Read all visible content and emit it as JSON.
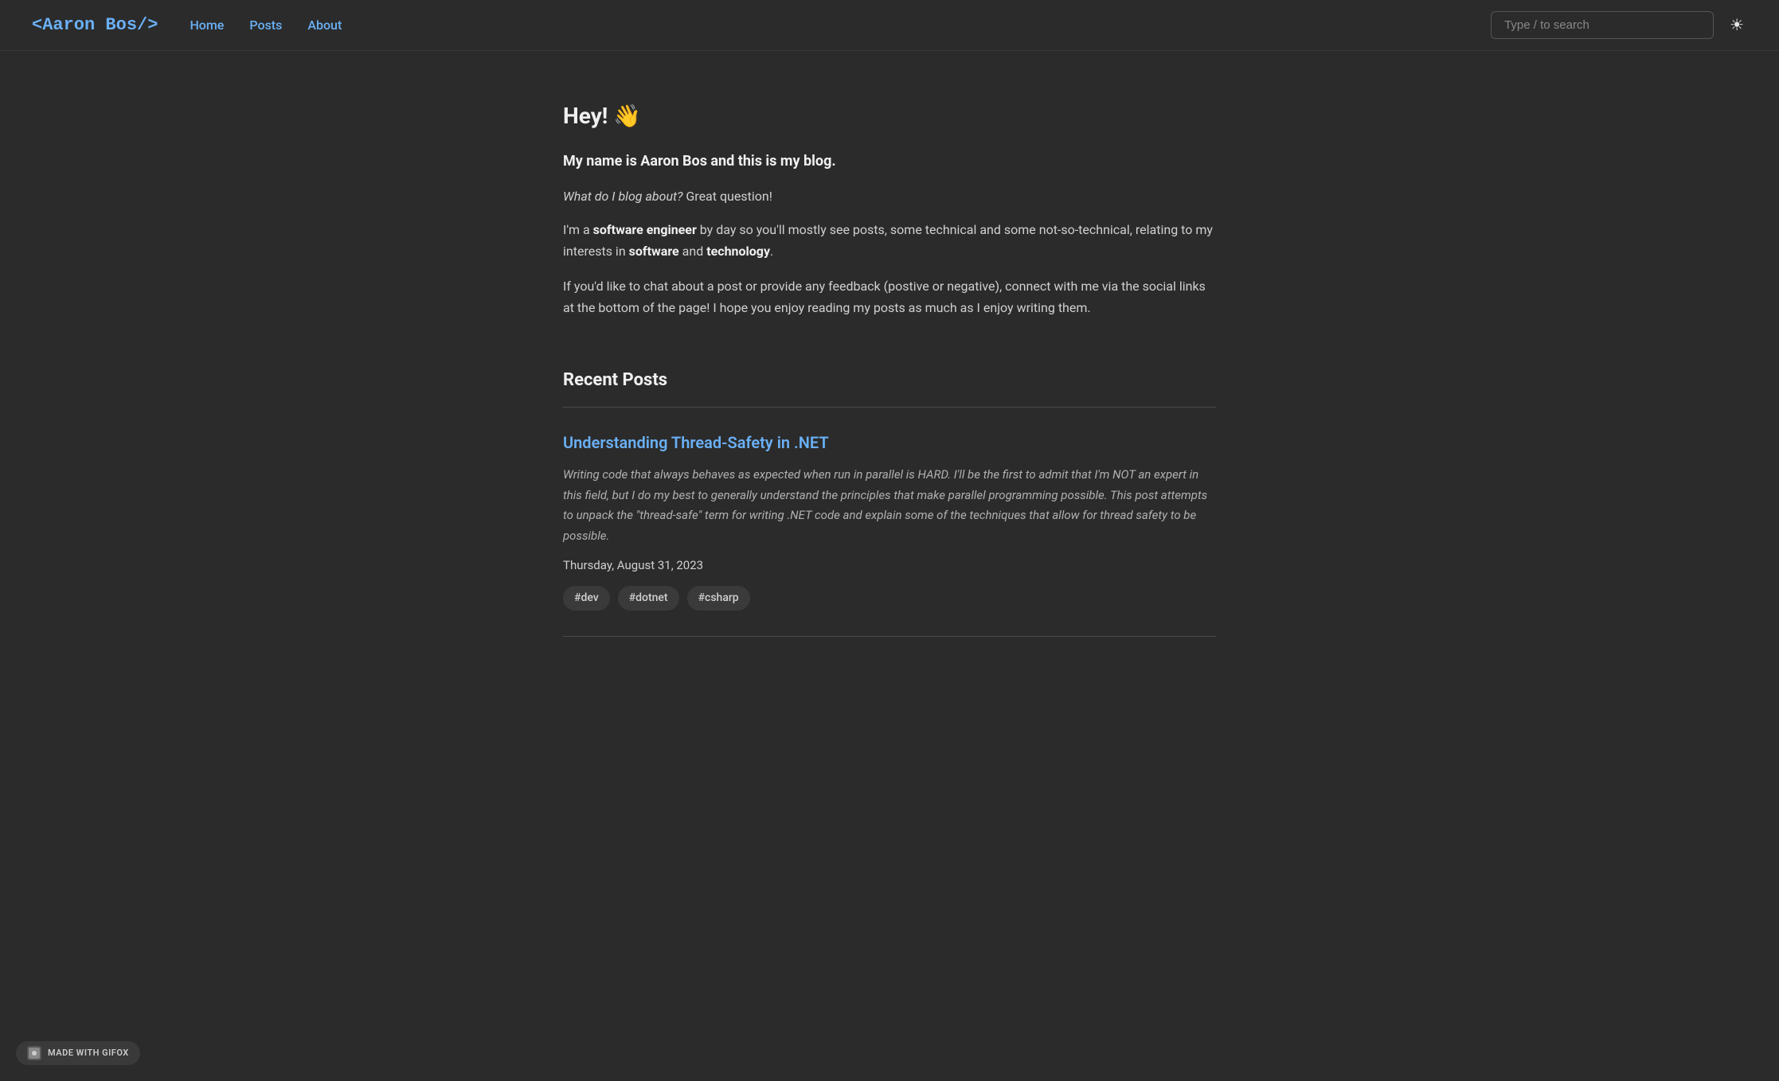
{
  "site": {
    "logo": "<Aaron Bos/>",
    "nav": {
      "links": [
        {
          "label": "Home",
          "href": "#"
        },
        {
          "label": "Posts",
          "href": "#"
        },
        {
          "label": "About",
          "href": "#"
        }
      ]
    },
    "search": {
      "placeholder": "Type / to search"
    },
    "theme_toggle_icon": "☀"
  },
  "hero": {
    "title": "Hey! 👋",
    "subtitle": "My name is Aaron Bos and this is my blog.",
    "question_italic": "What do I blog about?",
    "question_rest": " Great question!",
    "body1_pre": "I'm a ",
    "body1_bold1": "software engineer",
    "body1_mid": " by day so you'll mostly see posts, some technical and some not-so-technical, relating to my interests in ",
    "body1_bold2": "software",
    "body1_and": " and ",
    "body1_bold3": "technology",
    "body1_end": ".",
    "body2": "If you'd like to chat about a post or provide any feedback (postive or negative), connect with me via the social links at the bottom of the page! I hope you enjoy reading my posts as much as I enjoy writing them."
  },
  "recent_posts": {
    "section_title": "Recent Posts",
    "posts": [
      {
        "title": "Understanding Thread-Safety in .NET",
        "href": "#",
        "excerpt": "Writing code that always behaves as expected when run in parallel is HARD. I'll be the first to admit that I'm NOT an expert in this field, but I do my best to generally understand the principles that make parallel programming possible. This post attempts to unpack the \"thread-safe\" term for writing .NET code and explain some of the techniques that allow for thread safety to be possible.",
        "date": "Thursday, August 31, 2023",
        "tags": [
          "#dev",
          "#dotnet",
          "#csharp"
        ]
      }
    ]
  },
  "footer_badge": {
    "label": "MADE WITH GIFOX"
  }
}
